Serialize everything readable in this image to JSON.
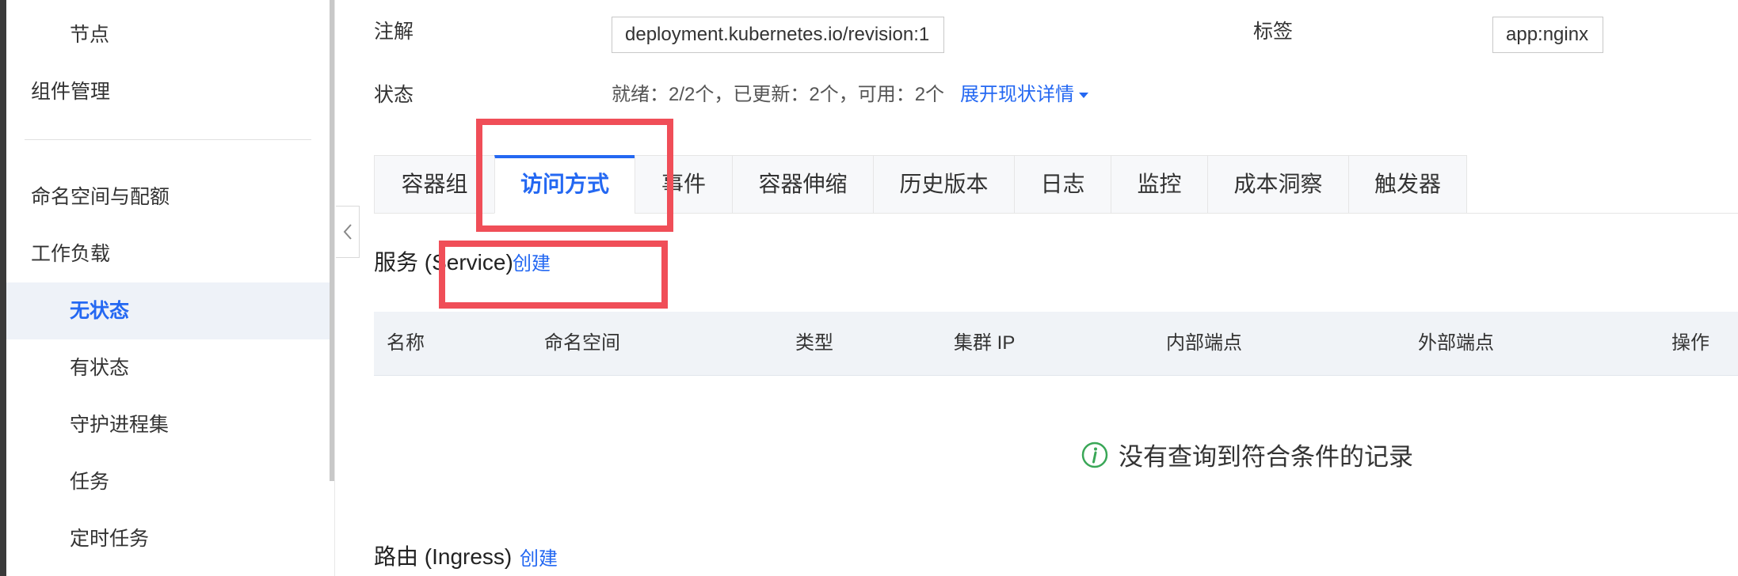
{
  "sidebar": {
    "items": [
      {
        "label": "节点"
      },
      {
        "label": "组件管理"
      },
      {
        "label": "命名空间与配额"
      },
      {
        "label": "工作负载"
      },
      {
        "label": "无状态"
      },
      {
        "label": "有状态"
      },
      {
        "label": "守护进程集"
      },
      {
        "label": "任务"
      },
      {
        "label": "定时任务"
      }
    ]
  },
  "details": {
    "annotation_label": "注解",
    "annotation_value": "deployment.kubernetes.io/revision:1",
    "tag_label": "标签",
    "tag_value": "app:nginx",
    "status_label": "状态",
    "status_text": "就绪：2/2个，已更新：2个，可用：2个",
    "expand_label": "展开现状详情"
  },
  "tabs": [
    {
      "label": "容器组"
    },
    {
      "label": "访问方式"
    },
    {
      "label": "事件"
    },
    {
      "label": "容器伸缩"
    },
    {
      "label": "历史版本"
    },
    {
      "label": "日志"
    },
    {
      "label": "监控"
    },
    {
      "label": "成本洞察"
    },
    {
      "label": "触发器"
    }
  ],
  "service_section": {
    "title": "服务 (Service)",
    "create_label": "创建",
    "columns": [
      "名称",
      "命名空间",
      "类型",
      "集群 IP",
      "内部端点",
      "外部端点",
      "操作"
    ],
    "empty_text": "没有查询到符合条件的记录"
  },
  "ingress_section": {
    "title": "路由 (Ingress)",
    "create_label": "创建"
  },
  "colors": {
    "accent": "#2468f2",
    "annotation_red": "#f04e58",
    "empty_icon": "#3aa757"
  },
  "icons": {
    "collapse": "chevron-left-icon",
    "expand_caret": "caret-down-icon",
    "empty": "info-circle-icon"
  }
}
